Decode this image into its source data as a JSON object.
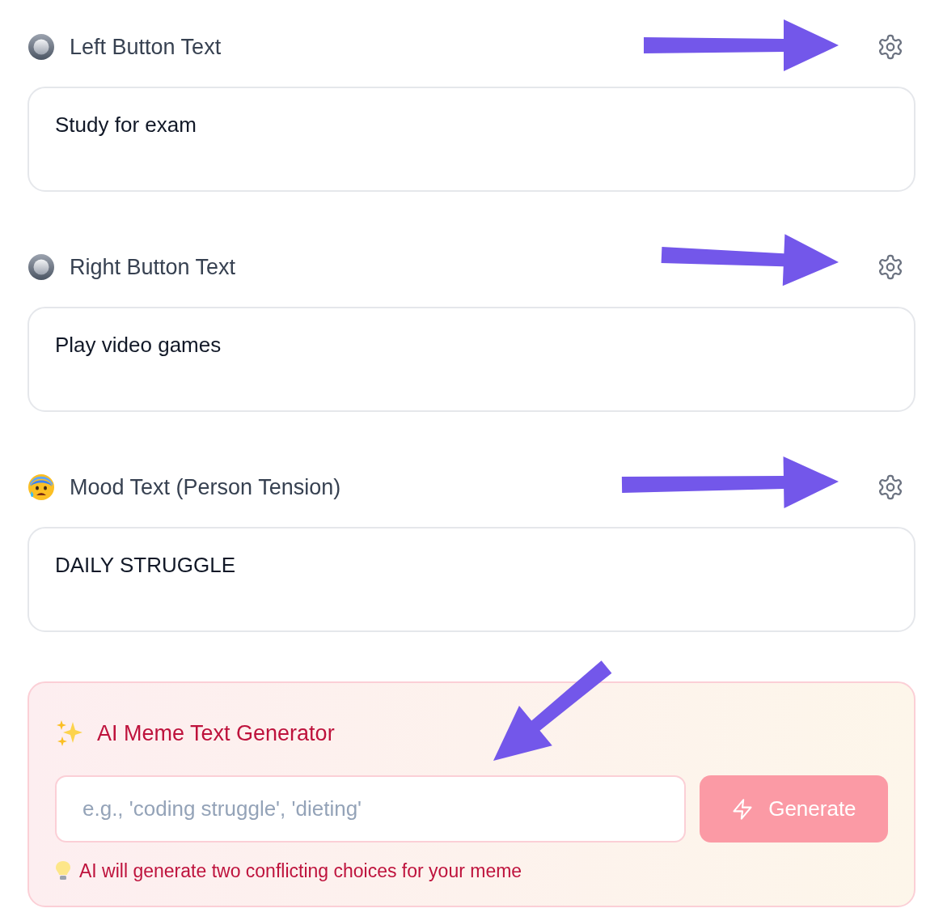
{
  "fields": [
    {
      "kind": "radio",
      "label": "Left Button Text",
      "value": "Study for exam"
    },
    {
      "kind": "radio",
      "label": "Right Button Text",
      "value": "Play video games"
    },
    {
      "kind": "mood",
      "label": "Mood Text (Person Tension)",
      "value": "DAILY STRUGGLE"
    }
  ],
  "generator": {
    "title": "AI Meme Text Generator",
    "placeholder": "e.g., 'coding struggle', 'dieting'",
    "button": {
      "label": "Generate",
      "disabled": true
    },
    "hint": "AI will generate two conflicting choices for your meme"
  }
}
